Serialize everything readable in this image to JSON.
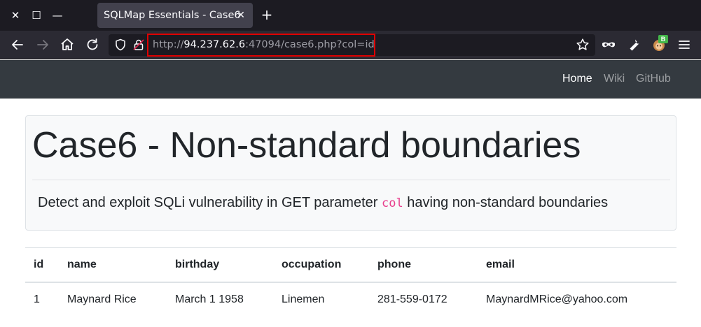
{
  "browser": {
    "tab_title": "SQLMap Essentials - Case6",
    "url_scheme": "http://",
    "url_host": "94.237.62.6",
    "url_rest": ":47094/case6.php?col=id",
    "extension_badge": "B",
    "window_controls": [
      "close-icon",
      "maximize-icon",
      "minimize-icon"
    ],
    "nav_icons": [
      "back-arrow-icon",
      "forward-arrow-icon",
      "home-icon",
      "reload-icon"
    ],
    "toolbar_icons": [
      "bookmark-star-icon",
      "private-mask-icon",
      "wrench-icon",
      "extension-avatar-icon",
      "hamburger-menu-icon"
    ]
  },
  "site_nav": {
    "items": [
      "Home",
      "Wiki",
      "GitHub"
    ]
  },
  "jumbotron": {
    "title": "Case6 - Non-standard boundaries",
    "desc_before": "Detect and exploit SQLi vulnerability in GET parameter ",
    "desc_code": "col",
    "desc_after": " having non-standard boundaries"
  },
  "table": {
    "columns": [
      "id",
      "name",
      "birthday",
      "occupation",
      "phone",
      "email"
    ],
    "rows": [
      [
        "1",
        "Maynard Rice",
        "March 1 1958",
        "Linemen",
        "281-559-0172",
        "MaynardMRice@yahoo.com"
      ]
    ]
  },
  "colors": {
    "chrome_dark": "#1c1b22",
    "chrome_nav": "#2b2a33",
    "site_nav": "#343a40",
    "url_highlight": "#e00000",
    "code_pink": "#e83e8c"
  }
}
